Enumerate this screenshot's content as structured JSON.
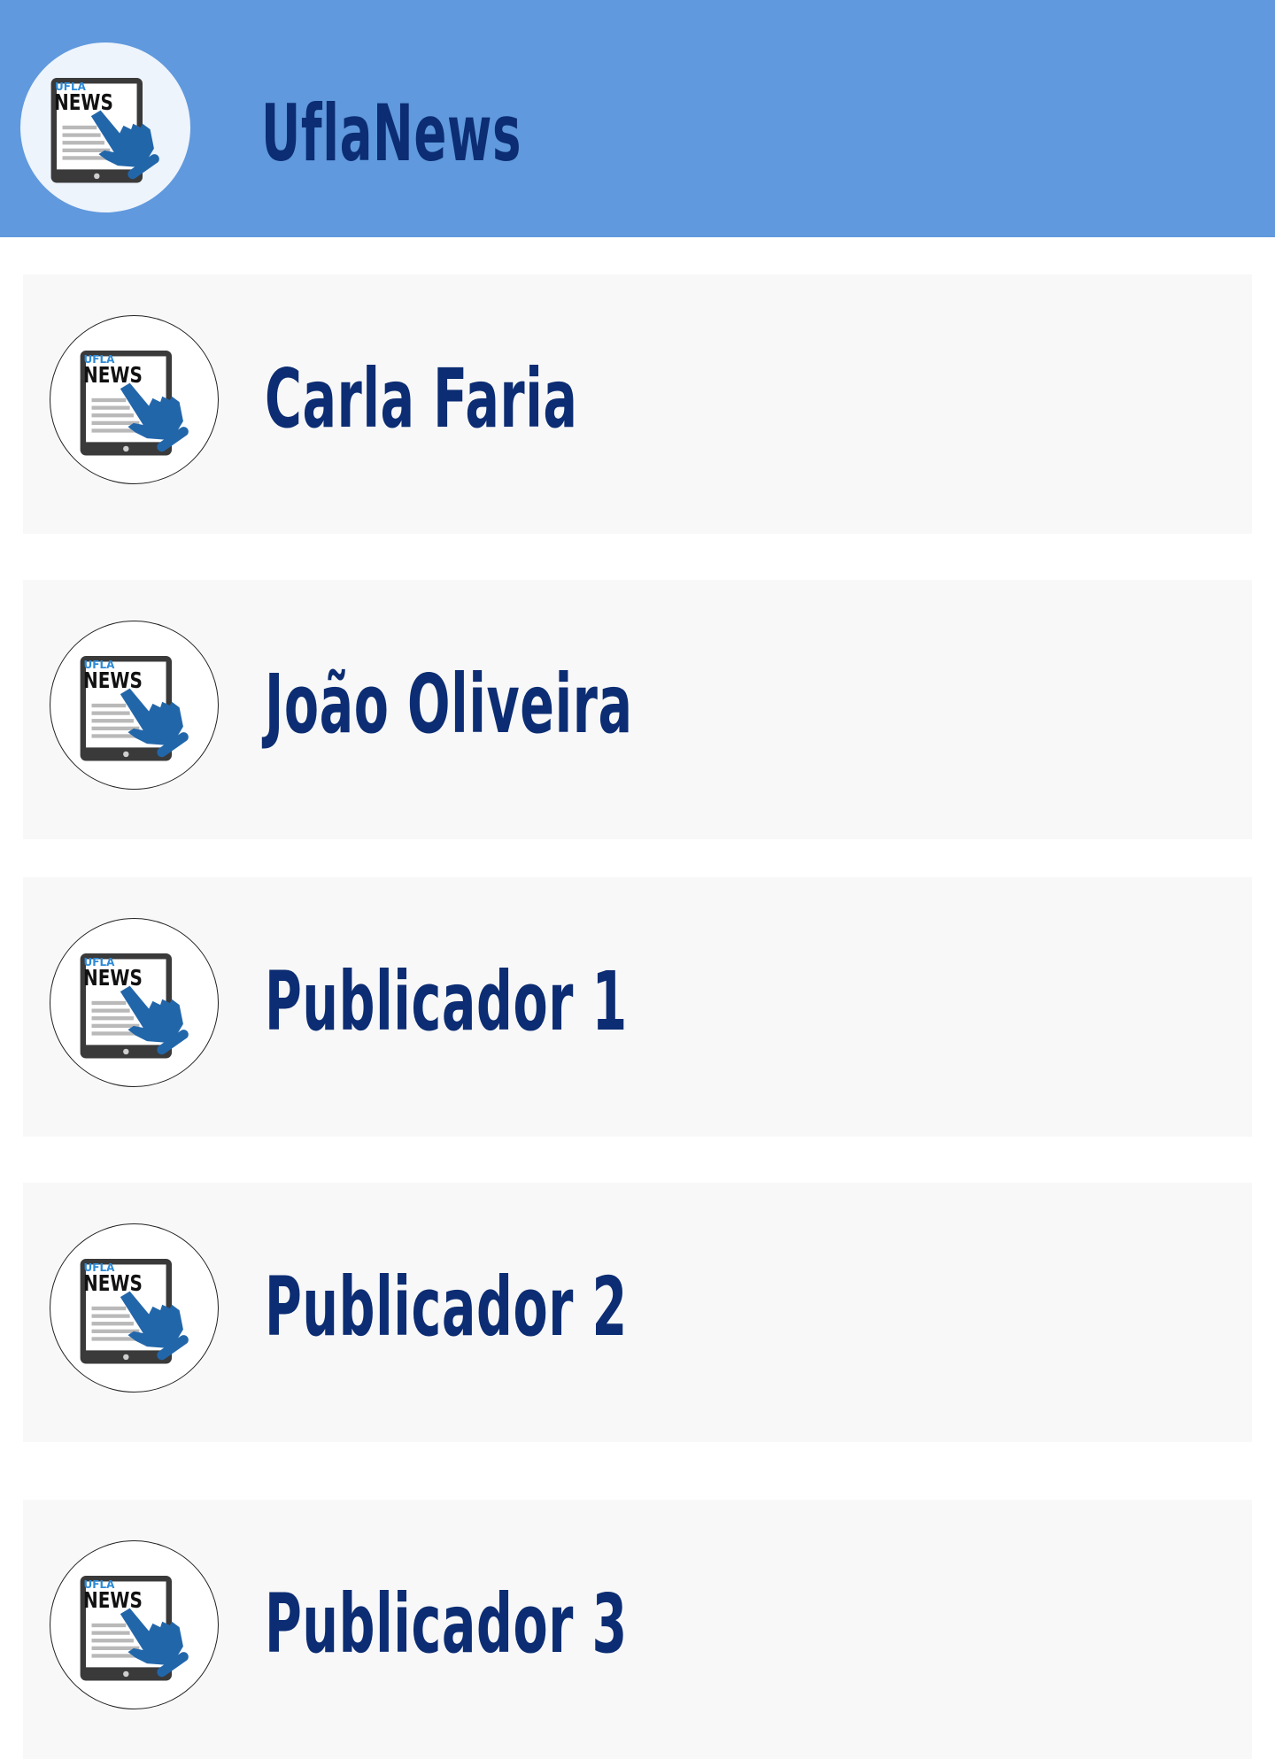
{
  "header": {
    "app_title": "UflaNews",
    "logo_text_small": "UFLA",
    "logo_text_big": "NEWS",
    "logo_icon": "news-tablet-pointer-icon",
    "background_color": "#6099dd"
  },
  "publishers": [
    {
      "name": "Carla Faria",
      "avatar_icon": "news-tablet-pointer-icon",
      "avatar_text_small": "UFLA",
      "avatar_text_big": "NEWS"
    },
    {
      "name": "João Oliveira",
      "avatar_icon": "news-tablet-pointer-icon",
      "avatar_text_small": "UFLA",
      "avatar_text_big": "NEWS"
    },
    {
      "name": "Publicador 1",
      "avatar_icon": "news-tablet-pointer-icon",
      "avatar_text_small": "UFLA",
      "avatar_text_big": "NEWS"
    },
    {
      "name": "Publicador 2",
      "avatar_icon": "news-tablet-pointer-icon",
      "avatar_text_small": "UFLA",
      "avatar_text_big": "NEWS"
    },
    {
      "name": "Publicador 3",
      "avatar_icon": "news-tablet-pointer-icon",
      "avatar_text_small": "UFLA",
      "avatar_text_big": "NEWS"
    }
  ],
  "colors": {
    "title_text": "#0c2d73",
    "item_background": "#f8f8f8",
    "icon_blue": "#2266aa"
  }
}
